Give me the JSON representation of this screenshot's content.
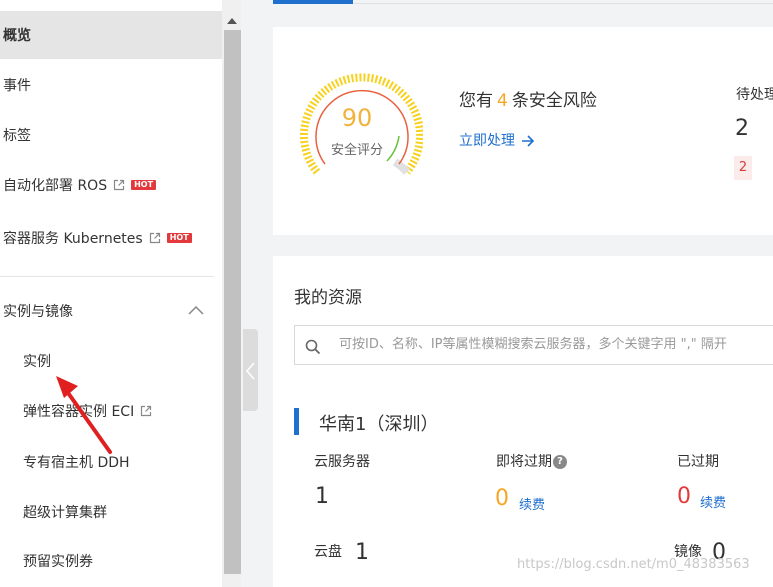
{
  "sidebar": {
    "items": [
      {
        "label": "概览"
      },
      {
        "label": "事件"
      },
      {
        "label": "标签"
      },
      {
        "label": "自动化部署 ROS",
        "badge": "HOT"
      },
      {
        "label": "容器服务 Kubernetes",
        "badge": "HOT"
      }
    ],
    "group": {
      "label": "实例与镜像",
      "children": [
        {
          "label": "实例"
        },
        {
          "label": "弹性容器实例 ECI"
        },
        {
          "label": "专有宿主机 DDH"
        },
        {
          "label": "超级计算集群"
        },
        {
          "label": "预留实例券"
        }
      ]
    }
  },
  "security": {
    "score": "90",
    "score_label": "安全评分",
    "risk_prefix": "您有",
    "risk_count": "4",
    "risk_suffix": "条安全风险",
    "action_link": "立即处理",
    "pending_label": "待处理",
    "pending_value": "2",
    "pending_badge": "2"
  },
  "resources": {
    "title": "我的资源",
    "search_placeholder": "可按ID、名称、IP等属性模糊搜索云服务器，多个关键字用 \",\" 隔开",
    "region": {
      "name": "华南1（深圳）",
      "ecs_label": "云服务器",
      "ecs_count": "1",
      "expiring_label": "即将过期",
      "expiring_count": "0",
      "expiring_renew": "续费",
      "expired_label": "已过期",
      "expired_count": "0",
      "expired_renew": "续费",
      "disk_label": "云盘",
      "disk_count": "1",
      "image_label": "镜像",
      "image_count": "0"
    }
  },
  "watermark": "https://blog.csdn.net/m0_48383563",
  "colors": {
    "accent": "#1f6fce",
    "warn": "#f5a623",
    "danger": "#e4393c",
    "annotation_arrow": "#e02020"
  }
}
